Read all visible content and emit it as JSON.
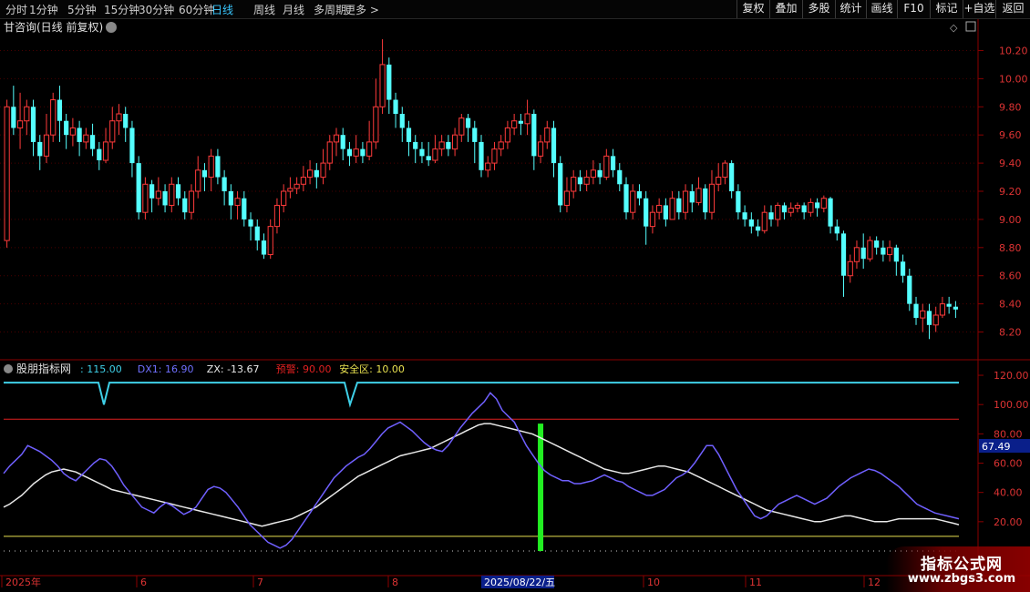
{
  "toolbar": {
    "left_items": [
      "分时",
      "1分钟",
      "5分钟",
      "15分钟",
      "30分钟",
      "60分钟",
      "日线",
      "周线",
      "月线",
      "多周期",
      "更多 >"
    ],
    "active_item": "日线",
    "right_items": [
      "复权",
      "叠加",
      "多股",
      "统计",
      "画线",
      "F10",
      "标记",
      "+自选",
      "返回"
    ]
  },
  "main_panel": {
    "title": "甘咨询(日线 前复权)",
    "y_ticks": [
      "10.20",
      "10.00",
      "9.80",
      "9.60",
      "9.40",
      "9.20",
      "9.00",
      "8.80",
      "8.60",
      "8.40",
      "8.20"
    ]
  },
  "indicator_panel": {
    "name": "股朋指标网",
    "items": [
      {
        "label": ": 115.00",
        "color": "#3fd0e8"
      },
      {
        "label": "DX1: 16.90",
        "color": "#7070ff"
      },
      {
        "label": "ZX: -13.67",
        "color": "#e8e8e8"
      },
      {
        "label": "预警: 90.00",
        "color": "#e02020"
      },
      {
        "label": "安全区: 10.00",
        "color": "#e8e050"
      }
    ],
    "y_ticks": [
      "120.00",
      "100.00",
      "80.00",
      "60.00",
      "40.00",
      "20.00"
    ],
    "current_value": "67.49"
  },
  "x_axis": {
    "labels": [
      "2025年",
      "6",
      "7",
      "8",
      "10",
      "11",
      "12"
    ],
    "highlight": "2025/08/22/五"
  },
  "watermark": {
    "line1": "指标公式网",
    "line2": "www.zbgs3.com"
  },
  "colors": {
    "up": "#ff3b3b",
    "down": "#54ffff",
    "grid": "#5a0000",
    "axis": "#8b0000"
  },
  "chart_data": {
    "type": "candlestick",
    "price_ylim": [
      8.1,
      10.3
    ],
    "candles": [
      [
        8.85,
        9.8,
        9.85,
        8.8
      ],
      [
        9.8,
        9.65,
        9.95,
        9.6
      ],
      [
        9.65,
        9.7,
        9.9,
        9.5
      ],
      [
        9.7,
        9.8,
        9.85,
        9.6
      ],
      [
        9.8,
        9.55,
        9.85,
        9.45
      ],
      [
        9.55,
        9.45,
        9.6,
        9.35
      ],
      [
        9.45,
        9.6,
        9.75,
        9.4
      ],
      [
        9.6,
        9.85,
        9.9,
        9.55
      ],
      [
        9.85,
        9.7,
        9.95,
        9.55
      ],
      [
        9.7,
        9.6,
        9.75,
        9.5
      ],
      [
        9.6,
        9.65,
        9.72,
        9.52
      ],
      [
        9.65,
        9.55,
        9.7,
        9.45
      ],
      [
        9.55,
        9.6,
        9.65,
        9.5
      ],
      [
        9.6,
        9.5,
        9.68,
        9.45
      ],
      [
        9.5,
        9.42,
        9.55,
        9.35
      ],
      [
        9.42,
        9.55,
        9.65,
        9.4
      ],
      [
        9.55,
        9.7,
        9.8,
        9.5
      ],
      [
        9.7,
        9.75,
        9.82,
        9.6
      ],
      [
        9.75,
        9.65,
        9.8,
        9.55
      ],
      [
        9.65,
        9.4,
        9.7,
        9.3
      ],
      [
        9.4,
        9.05,
        9.45,
        9.0
      ],
      [
        9.05,
        9.25,
        9.3,
        9.0
      ],
      [
        9.25,
        9.15,
        9.28,
        9.05
      ],
      [
        9.15,
        9.2,
        9.3,
        9.1
      ],
      [
        9.2,
        9.1,
        9.25,
        9.05
      ],
      [
        9.1,
        9.25,
        9.3,
        9.05
      ],
      [
        9.25,
        9.15,
        9.3,
        9.1
      ],
      [
        9.15,
        9.05,
        9.2,
        9.0
      ],
      [
        9.05,
        9.2,
        9.25,
        9.0
      ],
      [
        9.2,
        9.35,
        9.45,
        9.15
      ],
      [
        9.35,
        9.3,
        9.4,
        9.2
      ],
      [
        9.3,
        9.45,
        9.5,
        9.2
      ],
      [
        9.45,
        9.3,
        9.5,
        9.25
      ],
      [
        9.3,
        9.2,
        9.35,
        9.1
      ],
      [
        9.2,
        9.1,
        9.25,
        9.0
      ],
      [
        9.1,
        9.15,
        9.2,
        9.0
      ],
      [
        9.15,
        9.0,
        9.2,
        8.95
      ],
      [
        9.0,
        8.95,
        9.05,
        8.85
      ],
      [
        8.95,
        8.85,
        9.0,
        8.78
      ],
      [
        8.85,
        8.75,
        8.9,
        8.72
      ],
      [
        8.75,
        8.95,
        9.0,
        8.72
      ],
      [
        8.95,
        9.1,
        9.15,
        8.9
      ],
      [
        9.1,
        9.2,
        9.25,
        9.05
      ],
      [
        9.2,
        9.22,
        9.3,
        9.15
      ],
      [
        9.22,
        9.25,
        9.3,
        9.18
      ],
      [
        9.25,
        9.3,
        9.38,
        9.2
      ],
      [
        9.3,
        9.35,
        9.42,
        9.25
      ],
      [
        9.35,
        9.3,
        9.4,
        9.22
      ],
      [
        9.3,
        9.4,
        9.5,
        9.25
      ],
      [
        9.4,
        9.55,
        9.6,
        9.35
      ],
      [
        9.55,
        9.6,
        9.65,
        9.45
      ],
      [
        9.6,
        9.5,
        9.65,
        9.42
      ],
      [
        9.5,
        9.45,
        9.55,
        9.38
      ],
      [
        9.45,
        9.5,
        9.6,
        9.4
      ],
      [
        9.5,
        9.45,
        9.55,
        9.4
      ],
      [
        9.45,
        9.55,
        9.7,
        9.42
      ],
      [
        9.55,
        9.8,
        10.0,
        9.5
      ],
      [
        9.8,
        10.1,
        10.28,
        9.75
      ],
      [
        10.1,
        9.85,
        10.15,
        9.75
      ],
      [
        9.85,
        9.75,
        9.9,
        9.65
      ],
      [
        9.75,
        9.65,
        9.8,
        9.55
      ],
      [
        9.65,
        9.55,
        9.7,
        9.45
      ],
      [
        9.55,
        9.5,
        9.6,
        9.4
      ],
      [
        9.5,
        9.45,
        9.55,
        9.4
      ],
      [
        9.45,
        9.42,
        9.55,
        9.38
      ],
      [
        9.42,
        9.5,
        9.6,
        9.4
      ],
      [
        9.5,
        9.55,
        9.6,
        9.45
      ],
      [
        9.55,
        9.5,
        9.6,
        9.45
      ],
      [
        9.5,
        9.6,
        9.65,
        9.45
      ],
      [
        9.6,
        9.72,
        9.75,
        9.55
      ],
      [
        9.72,
        9.65,
        9.75,
        9.55
      ],
      [
        9.65,
        9.55,
        9.7,
        9.4
      ],
      [
        9.55,
        9.35,
        9.6,
        9.3
      ],
      [
        9.35,
        9.4,
        9.45,
        9.3
      ],
      [
        9.4,
        9.5,
        9.55,
        9.35
      ],
      [
        9.5,
        9.55,
        9.6,
        9.45
      ],
      [
        9.55,
        9.65,
        9.7,
        9.5
      ],
      [
        9.65,
        9.7,
        9.75,
        9.6
      ],
      [
        9.7,
        9.68,
        9.75,
        9.6
      ],
      [
        9.68,
        9.75,
        9.85,
        9.6
      ],
      [
        9.75,
        9.45,
        9.78,
        9.35
      ],
      [
        9.45,
        9.55,
        9.6,
        9.4
      ],
      [
        9.55,
        9.65,
        9.7,
        9.5
      ],
      [
        9.65,
        9.4,
        9.7,
        9.3
      ],
      [
        9.4,
        9.1,
        9.45,
        9.05
      ],
      [
        9.1,
        9.2,
        9.3,
        9.05
      ],
      [
        9.2,
        9.3,
        9.35,
        9.15
      ],
      [
        9.3,
        9.25,
        9.35,
        9.2
      ],
      [
        9.25,
        9.3,
        9.35,
        9.2
      ],
      [
        9.3,
        9.35,
        9.42,
        9.25
      ],
      [
        9.35,
        9.3,
        9.4,
        9.25
      ],
      [
        9.3,
        9.45,
        9.5,
        9.28
      ],
      [
        9.45,
        9.35,
        9.5,
        9.3
      ],
      [
        9.35,
        9.25,
        9.4,
        9.2
      ],
      [
        9.25,
        9.05,
        9.3,
        9.0
      ],
      [
        9.05,
        9.2,
        9.25,
        9.0
      ],
      [
        9.2,
        9.15,
        9.25,
        9.1
      ],
      [
        9.15,
        8.95,
        9.2,
        8.82
      ],
      [
        8.95,
        9.05,
        9.1,
        8.9
      ],
      [
        9.05,
        9.1,
        9.15,
        9.0
      ],
      [
        9.1,
        9.0,
        9.15,
        8.95
      ],
      [
        9.0,
        9.15,
        9.2,
        9.0
      ],
      [
        9.15,
        9.05,
        9.2,
        9.0
      ],
      [
        9.05,
        9.2,
        9.25,
        9.0
      ],
      [
        9.2,
        9.12,
        9.25,
        9.05
      ],
      [
        9.12,
        9.22,
        9.3,
        9.1
      ],
      [
        9.22,
        9.05,
        9.25,
        9.0
      ],
      [
        9.05,
        9.25,
        9.35,
        9.0
      ],
      [
        9.25,
        9.3,
        9.4,
        9.2
      ],
      [
        9.3,
        9.4,
        9.42,
        9.25
      ],
      [
        9.4,
        9.2,
        9.42,
        9.15
      ],
      [
        9.2,
        9.05,
        9.25,
        9.0
      ],
      [
        9.05,
        9.0,
        9.1,
        8.95
      ],
      [
        9.0,
        8.95,
        9.05,
        8.9
      ],
      [
        8.95,
        8.92,
        9.0,
        8.88
      ],
      [
        8.92,
        9.05,
        9.1,
        8.9
      ],
      [
        9.05,
        9.0,
        9.1,
        8.95
      ],
      [
        9.0,
        9.1,
        9.12,
        8.95
      ],
      [
        9.1,
        9.05,
        9.12,
        9.0
      ],
      [
        9.05,
        9.08,
        9.12,
        9.02
      ],
      [
        9.08,
        9.1,
        9.12,
        9.05
      ],
      [
        9.1,
        9.05,
        9.12,
        9.0
      ],
      [
        9.05,
        9.12,
        9.15,
        9.02
      ],
      [
        9.12,
        9.08,
        9.15,
        9.02
      ],
      [
        9.08,
        9.15,
        9.17,
        9.05
      ],
      [
        9.15,
        8.95,
        9.16,
        8.9
      ],
      [
        8.95,
        8.9,
        9.0,
        8.85
      ],
      [
        8.9,
        8.6,
        8.92,
        8.45
      ],
      [
        8.6,
        8.7,
        8.75,
        8.55
      ],
      [
        8.7,
        8.8,
        8.85,
        8.65
      ],
      [
        8.8,
        8.72,
        8.9,
        8.65
      ],
      [
        8.72,
        8.85,
        8.88,
        8.7
      ],
      [
        8.85,
        8.8,
        8.88,
        8.75
      ],
      [
        8.8,
        8.75,
        8.85,
        8.7
      ],
      [
        8.75,
        8.8,
        8.85,
        8.7
      ],
      [
        8.8,
        8.7,
        8.82,
        8.6
      ],
      [
        8.7,
        8.6,
        8.75,
        8.55
      ],
      [
        8.6,
        8.4,
        8.65,
        8.35
      ],
      [
        8.4,
        8.3,
        8.45,
        8.25
      ],
      [
        8.3,
        8.35,
        8.4,
        8.2
      ],
      [
        8.35,
        8.25,
        8.4,
        8.15
      ],
      [
        8.25,
        8.32,
        8.38,
        8.2
      ],
      [
        8.32,
        8.4,
        8.45,
        8.3
      ],
      [
        8.4,
        8.38,
        8.45,
        8.33
      ],
      [
        8.38,
        8.36,
        8.42,
        8.3
      ]
    ],
    "indicator_ylim": [
      0,
      125
    ],
    "dx1": [
      53,
      58,
      62,
      66,
      72,
      70,
      68,
      65,
      62,
      58,
      53,
      50,
      48,
      52,
      56,
      60,
      63,
      62,
      58,
      52,
      45,
      40,
      35,
      30,
      28,
      26,
      30,
      33,
      31,
      28,
      25,
      27,
      30,
      36,
      42,
      44,
      43,
      40,
      35,
      30,
      24,
      18,
      14,
      10,
      6,
      4,
      2,
      4,
      8,
      14,
      20,
      26,
      32,
      38,
      44,
      50,
      54,
      58,
      61,
      64,
      66,
      70,
      75,
      80,
      84,
      86,
      88,
      85,
      82,
      78,
      74,
      71,
      69,
      68,
      72,
      78,
      84,
      89,
      94,
      98,
      102,
      108,
      104,
      96,
      92,
      88,
      80,
      72,
      66,
      60,
      55,
      52,
      50,
      48,
      48,
      46,
      46,
      47,
      48,
      50,
      52,
      50,
      48,
      47,
      44,
      42,
      40,
      38,
      38,
      40,
      42,
      46,
      50,
      52,
      55,
      60,
      66,
      72,
      72,
      66,
      58,
      50,
      42,
      36,
      30,
      24,
      22,
      24,
      28,
      32,
      34,
      36,
      38,
      36,
      34,
      32,
      34,
      36,
      40,
      44,
      47,
      50,
      52,
      54,
      56,
      55,
      53,
      50,
      47,
      44,
      40,
      36,
      32,
      30,
      28,
      26,
      25,
      24,
      23,
      22
    ],
    "zx": [
      30,
      32,
      35,
      38,
      42,
      46,
      49,
      52,
      54,
      55,
      56,
      55,
      54,
      52,
      50,
      48,
      46,
      44,
      42,
      41,
      40,
      39,
      38,
      37,
      36,
      35,
      34,
      33,
      32,
      31,
      30,
      29,
      28,
      27,
      26,
      25,
      24,
      23,
      22,
      21,
      20,
      19,
      18,
      17,
      18,
      19,
      20,
      21,
      22,
      24,
      26,
      28,
      30,
      33,
      36,
      39,
      42,
      45,
      48,
      51,
      53,
      55,
      57,
      59,
      61,
      63,
      65,
      66,
      67,
      68,
      69,
      70,
      72,
      74,
      76,
      78,
      80,
      82,
      84,
      86,
      87,
      87,
      86,
      85,
      84,
      83,
      82,
      81,
      80,
      78,
      76,
      74,
      72,
      70,
      68,
      66,
      64,
      62,
      60,
      58,
      56,
      55,
      54,
      53,
      53,
      54,
      55,
      56,
      57,
      58,
      58,
      57,
      56,
      55,
      54,
      52,
      50,
      48,
      46,
      44,
      42,
      40,
      38,
      36,
      34,
      32,
      30,
      28,
      27,
      26,
      25,
      24,
      23,
      22,
      21,
      20,
      20,
      21,
      22,
      23,
      24,
      24,
      23,
      22,
      21,
      20,
      20,
      20,
      21,
      22,
      22,
      22,
      22,
      22,
      22,
      22,
      21,
      20,
      19,
      18
    ],
    "upper_line": [
      115,
      115,
      115,
      100,
      115,
      115,
      100,
      115,
      115
    ],
    "warning": 90,
    "safe_zone": 10,
    "signal_bar": {
      "index": 81,
      "from": 0,
      "to": 87
    }
  }
}
